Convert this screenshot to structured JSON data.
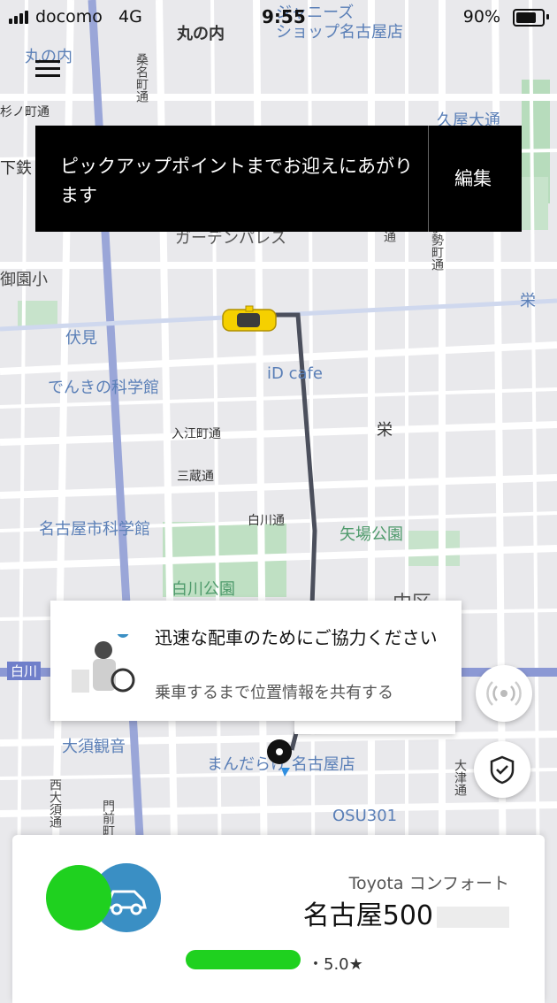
{
  "status_bar": {
    "carrier": "docomo",
    "network": "4G",
    "time": "9:55",
    "battery": "90%"
  },
  "banner": {
    "message": "ピックアップポイントまでお迎えにあがります",
    "edit_label": "編集"
  },
  "map": {
    "labels": {
      "marunouchi_top": "丸の内",
      "marunouchi_station": "丸の内",
      "johnnys_shop": "ジャニーズ\nショップ名古屋店",
      "hisaya_odori": "久屋大通",
      "sumiyoshi": "杉ノ町通",
      "shimo_tetsu": "下鉄",
      "garden_palace": "ガーデンパレス",
      "gyoen": "御園小",
      "fushimi": "伏見",
      "denki_museum": "でんきの科学館",
      "idcafe": "iD cafe",
      "sakae": "栄",
      "sakae_station": "栄",
      "irie": "入江町通",
      "mikura": "三蔵通",
      "shirakawa_dori": "白川通",
      "science_museum": "名古屋市科学館",
      "yaba_park": "矢場公園",
      "shirakawa_park": "白川公園",
      "naka_ku": "中区",
      "shirakawa": "白川",
      "osu_kannon": "大須観音",
      "mandarake": "まんだらけ 名古屋店",
      "osu301": "OSU301",
      "otsu_dori": "大津通",
      "nishi_osu": "西大須通",
      "monzen": "門前町通",
      "kuwana": "桑名町通",
      "ise": "伊勢町通",
      "chodo": "長者町通",
      "dori": "通"
    }
  },
  "share_card": {
    "title": "迅速な配車のためにご協力ください",
    "subtitle": "乗車するまで位置情報を共有する"
  },
  "driver": {
    "car_model": "Toyota コンフォート",
    "plate_prefix": "名古屋500",
    "rating": "・5.0★"
  },
  "icons": {
    "menu": "hamburger-icon",
    "share_location": "broadcast-icon",
    "safety": "shield-check-icon",
    "taxi": "taxi-car-icon",
    "pickup": "pickup-pin-icon"
  },
  "colors": {
    "route": "#4b4f5c",
    "accent_blue": "#3a8fc4",
    "banner_bg": "#000000",
    "taxi": "#f5d000"
  }
}
